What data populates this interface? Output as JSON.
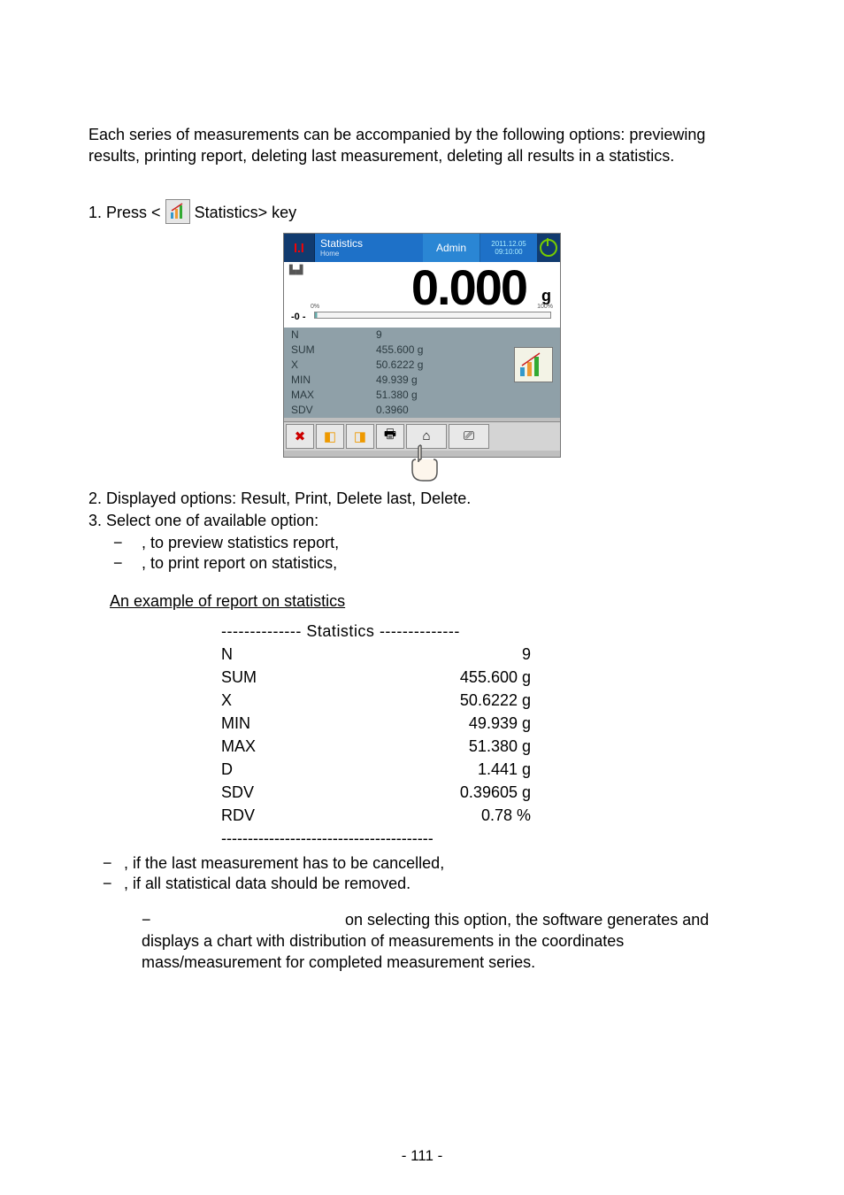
{
  "intro": "Each series of measurements can be accompanied by the following options: previewing results, printing report, deleting last measurement, deleting all results in a statistics.",
  "step1_prefix": "1. Press <",
  "step1_suffix": " Statistics> key",
  "device": {
    "title": "Statistics",
    "home": "Home",
    "admin": "Admin",
    "date": "2011.12.05",
    "time": "09:10:00",
    "reading": "0.000",
    "unit": "g",
    "zero": "-0 -",
    "p0": "0%",
    "p100": "100%",
    "rows": [
      {
        "lab": "N",
        "val": "9"
      },
      {
        "lab": "SUM",
        "val": "455.600 g"
      },
      {
        "lab": "X",
        "val": "50.6222 g"
      },
      {
        "lab": "MIN",
        "val": "49.939 g"
      },
      {
        "lab": "MAX",
        "val": "51.380 g"
      },
      {
        "lab": "SDV",
        "val": "0.3960"
      }
    ]
  },
  "step2": "2. Displayed options: Result, Print, Delete last, Delete.",
  "step3": "3. Select one of available option:",
  "opt_preview": ", to preview statistics report,",
  "opt_print": ", to print report on statistics,",
  "report_title": "An example of report on statistics",
  "report": {
    "header": "-------------- Statistics --------------",
    "rows": [
      {
        "lab": "N",
        "val": "9"
      },
      {
        "lab": "SUM",
        "val": "455.600 g"
      },
      {
        "lab": "X",
        "val": "50.6222 g"
      },
      {
        "lab": "MIN",
        "val": "49.939 g"
      },
      {
        "lab": "MAX",
        "val": "51.380 g"
      },
      {
        "lab": "D",
        "val": "1.441 g"
      },
      {
        "lab": "SDV",
        "val": "0.39605 g"
      },
      {
        "lab": "RDV",
        "val": "0.78 %"
      }
    ],
    "footer": "----------------------------------------"
  },
  "opt_delete_last": ", if the last measurement has to be cancelled,",
  "opt_delete_all": ", if all statistical data should be removed.",
  "opt_chart": " on selecting this option, the software generates and displays a chart with distribution of measurements in the coordinates mass/measurement for completed measurement series.",
  "page_number": "- 111 -",
  "chart_data": {
    "type": "table",
    "title": "Statistics",
    "series": [
      {
        "name": "N",
        "values": [
          9
        ]
      },
      {
        "name": "SUM",
        "values": [
          455.6
        ],
        "unit": "g"
      },
      {
        "name": "X",
        "values": [
          50.6222
        ],
        "unit": "g"
      },
      {
        "name": "MIN",
        "values": [
          49.939
        ],
        "unit": "g"
      },
      {
        "name": "MAX",
        "values": [
          51.38
        ],
        "unit": "g"
      },
      {
        "name": "D",
        "values": [
          1.441
        ],
        "unit": "g"
      },
      {
        "name": "SDV",
        "values": [
          0.39605
        ],
        "unit": "g"
      },
      {
        "name": "RDV",
        "values": [
          0.78
        ],
        "unit": "%"
      }
    ]
  }
}
